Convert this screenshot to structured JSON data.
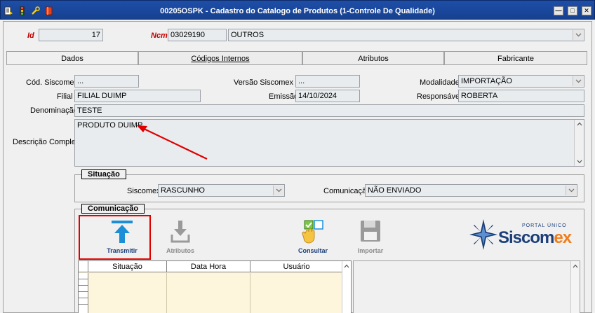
{
  "window": {
    "title": "00205OSPK - Cadastro do Catalogo de Produtos (1-Controle De Qualidade)",
    "controls": {
      "minimize": "—",
      "maximize": "□",
      "close": "✕"
    }
  },
  "header": {
    "id_label": "Id",
    "id_value": "17",
    "ncm_label": "Ncm",
    "ncm_code": "03029190",
    "ncm_description": "OUTROS"
  },
  "tabs": [
    {
      "label": "Dados",
      "active": true
    },
    {
      "label": "Códigos Internos",
      "active": false
    },
    {
      "label": "Atributos",
      "active": false
    },
    {
      "label": "Fabricante",
      "active": false
    }
  ],
  "form": {
    "cod_siscomex_label": "Cód. Siscomex",
    "cod_siscomex_value": "...",
    "versao_label": "Versão Siscomex",
    "versao_value": "...",
    "modalidade_label": "Modalidade",
    "modalidade_value": "IMPORTAÇÃO",
    "filial_label": "Filial",
    "filial_value": "FILIAL DUIMP",
    "emissao_label": "Emissão",
    "emissao_value": "14/10/2024",
    "responsavel_label": "Responsável",
    "responsavel_value": "ROBERTA",
    "denominacao_label": "Denominação",
    "denominacao_value": "TESTE",
    "descricao_label": "Descrição Completa",
    "descricao_value": "PRODUTO DUIMP"
  },
  "situacao": {
    "title": "Situação",
    "siscomex_label": "Siscomex",
    "siscomex_value": "RASCUNHO",
    "comunicacao_label": "Comunicação",
    "comunicacao_value": "NÃO ENVIADO"
  },
  "comunicacao": {
    "title": "Comunicação",
    "tools": {
      "transmitir": "Transmitir",
      "atributos": "Atributos",
      "consultar": "Consultar",
      "importar": "Importar"
    },
    "logo_top": "PORTAL ÚNICO",
    "logo_main": "Siscomex",
    "grid_columns": [
      "Situação",
      "Data Hora",
      "Usuário"
    ]
  },
  "colors": {
    "titlebar": "#1e4ea8",
    "highlight_red": "#e00000",
    "grid_background": "#fdf5dc",
    "logo_navy": "#1c3f79",
    "logo_orange": "#f07d1a",
    "transmit_blue": "#1a8fd8"
  }
}
